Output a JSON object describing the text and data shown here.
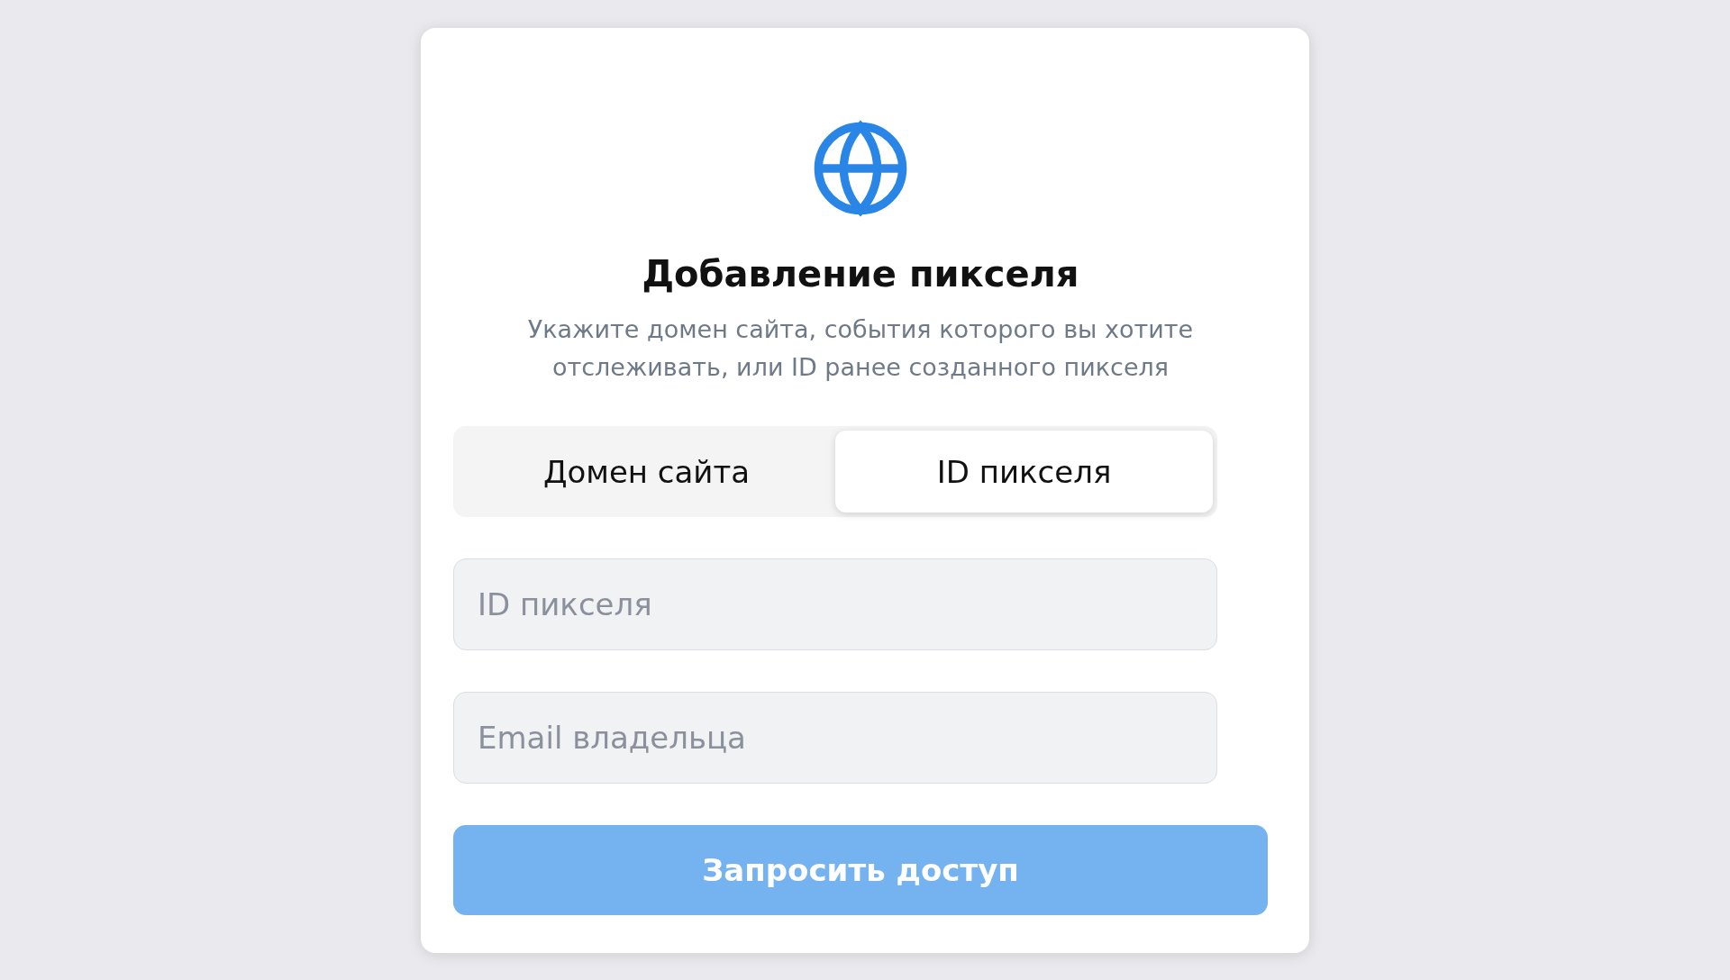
{
  "title": "Добавление пикселя",
  "description": "Укажите домен сайта, события которого вы хотите отслеживать, или ID ранее созданного пикселя",
  "tabs": [
    {
      "label": "Домен сайта",
      "selected": false
    },
    {
      "label": "ID пикселя",
      "selected": true
    }
  ],
  "fields": [
    {
      "placeholder": "ID пикселя"
    },
    {
      "placeholder": "Email владельца"
    }
  ],
  "submit": {
    "label": "Запросить доступ",
    "disabled": true
  }
}
